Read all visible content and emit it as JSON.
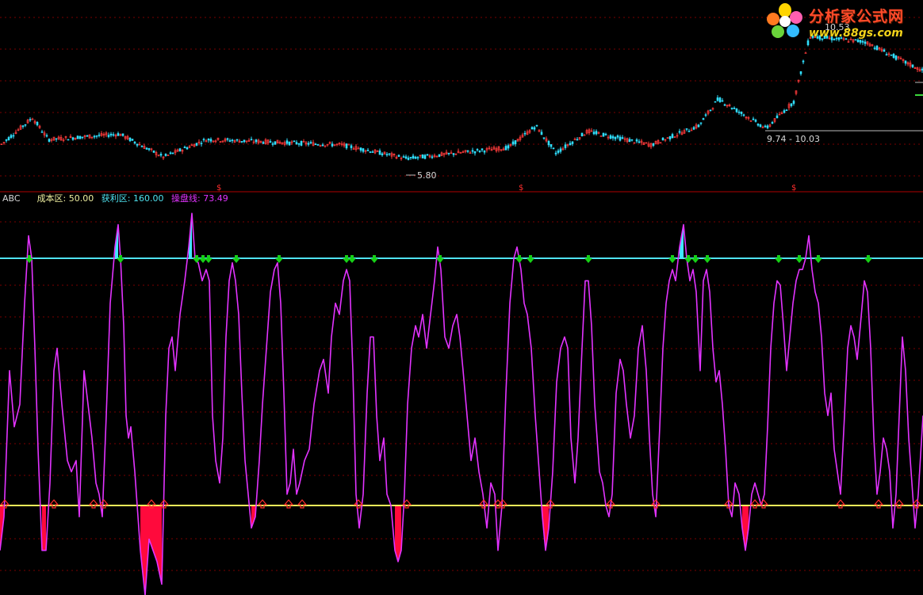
{
  "price_panel": {
    "low_label": "5.80",
    "range_label": "9.74 - 10.03",
    "peak_label": "10.53",
    "signal_marker": "$"
  },
  "indicator": {
    "name": "ABC",
    "cost_zone_label": "成本区:",
    "cost_zone_value": "50.00",
    "profit_zone_label": "获利区:",
    "profit_zone_value": "160.00",
    "trade_line_label": "操盘线:",
    "trade_line_value": "73.49"
  },
  "logo": {
    "title": "分析家公式网",
    "url": "www.88gs.com"
  },
  "colors": {
    "background": "#000000",
    "grid": "#7a0000",
    "price_up": "#ff3b3b",
    "price_down": "#30e0ff",
    "trade_line": "#e233ff",
    "cost_line": "#f5f55a",
    "profit_line": "#4fe3f0",
    "profit_fill": "#40e6ff",
    "cost_fill": "#ff0a3c",
    "buy_arrow": "#ff2d2d",
    "sell_arrow": "#16d016",
    "label_white": "#d8d8d8"
  },
  "chart_data": {
    "type": "line",
    "panels": [
      {
        "name": "price",
        "series_type": "candlestick",
        "annotations": [
          "5.80",
          "9.74 - 10.03",
          "10.53"
        ],
        "key_points": [
          {
            "x": 0,
            "y": 6.3
          },
          {
            "x": 40,
            "y": 7.3
          },
          {
            "x": 60,
            "y": 6.5
          },
          {
            "x": 150,
            "y": 6.7
          },
          {
            "x": 205,
            "y": 5.85
          },
          {
            "x": 260,
            "y": 6.5
          },
          {
            "x": 430,
            "y": 6.3
          },
          {
            "x": 512,
            "y": 5.8
          },
          {
            "x": 640,
            "y": 6.2
          },
          {
            "x": 675,
            "y": 7.0
          },
          {
            "x": 700,
            "y": 6.0
          },
          {
            "x": 740,
            "y": 6.8
          },
          {
            "x": 820,
            "y": 6.3
          },
          {
            "x": 880,
            "y": 7.0
          },
          {
            "x": 905,
            "y": 8.0
          },
          {
            "x": 965,
            "y": 6.9
          },
          {
            "x": 1000,
            "y": 7.9
          },
          {
            "x": 1020,
            "y": 10.3
          },
          {
            "x": 1090,
            "y": 10.1
          },
          {
            "x": 1164,
            "y": 9.0
          }
        ]
      },
      {
        "name": "ABC",
        "series": [
          {
            "name": "成本区",
            "values": [
              50
            ]
          },
          {
            "name": "获利区",
            "values": [
              160
            ]
          },
          {
            "name": "操盘线",
            "last": 73.49
          }
        ]
      }
    ]
  }
}
